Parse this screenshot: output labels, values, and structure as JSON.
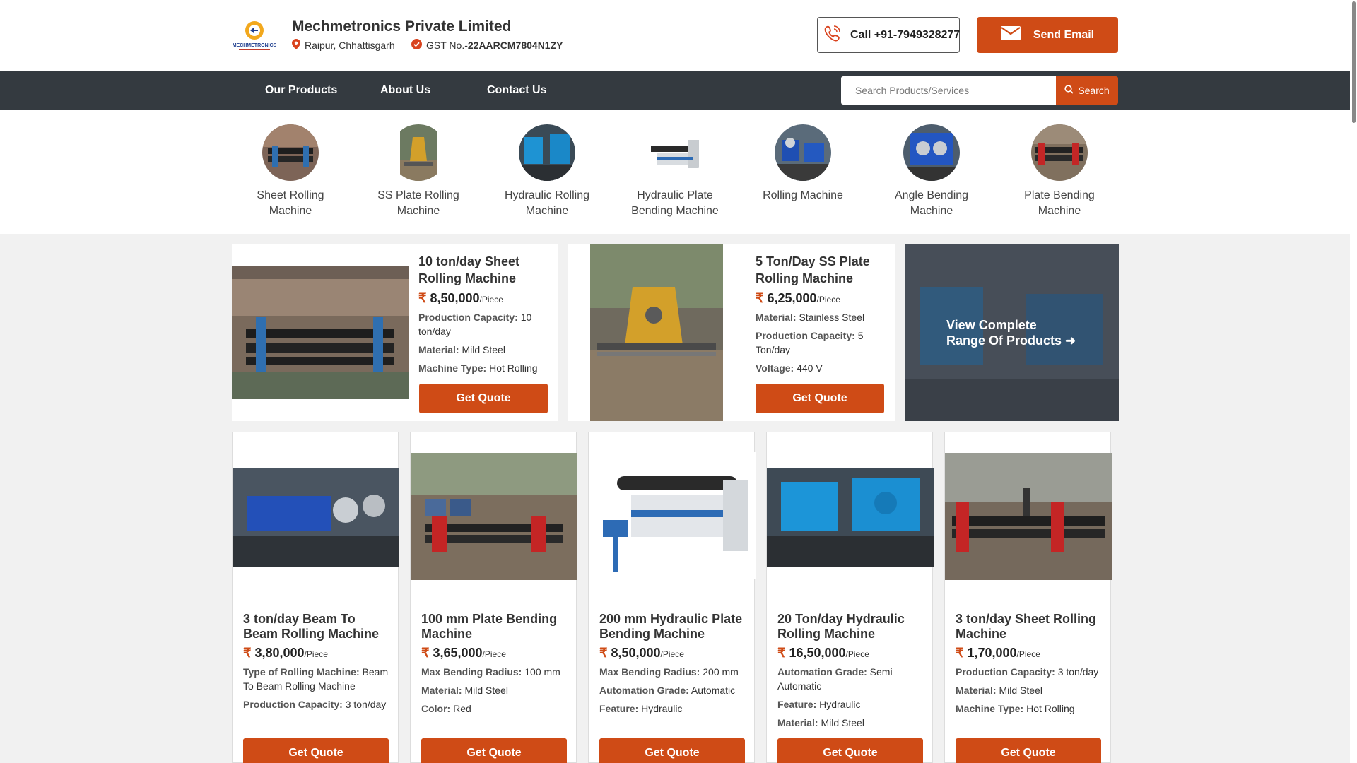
{
  "header": {
    "company": "Mechmetronics Private Limited",
    "location": "Raipur, Chhattisgarh",
    "gst_label": "GST No.-",
    "gst_value": "22AARCM7804N1ZY",
    "call": "Call +91-7949328277",
    "email": "Send Email",
    "logo_text": "MECHMETRONICS"
  },
  "nav": {
    "items": [
      "Our Products",
      "About Us",
      "Contact Us"
    ],
    "search_placeholder": "Search Products/Services",
    "search_button": "Search"
  },
  "categories": [
    "Sheet Rolling Machine",
    "SS Plate Rolling Machine",
    "Hydraulic Rolling Machine",
    "Hydraulic Plate Bending Machine",
    "Rolling Machine",
    "Angle Bending Machine",
    "Plate Bending Machine"
  ],
  "featured": [
    {
      "title": "10 ton/day Sheet Rolling Machine",
      "price": "8,50,000",
      "unit": "/Piece",
      "specs": [
        {
          "k": "Production Capacity:",
          "v": "10 ton/day"
        },
        {
          "k": "Material:",
          "v": "Mild Steel"
        },
        {
          "k": "Machine Type:",
          "v": "Hot Rolling"
        }
      ],
      "quote": "Get Quote"
    },
    {
      "title": "5 Ton/Day SS Plate Rolling Machine",
      "price": "6,25,000",
      "unit": "/Piece",
      "specs": [
        {
          "k": "Material:",
          "v": "Stainless Steel"
        },
        {
          "k": "Production Capacity:",
          "v": "5 Ton/day"
        },
        {
          "k": "Voltage:",
          "v": "440 V"
        }
      ],
      "quote": "Get Quote"
    }
  ],
  "view_all": {
    "line1": "View Complete",
    "line2": "Range Of Products"
  },
  "products": [
    {
      "title": "3 ton/day Beam To Beam Rolling Machine",
      "price": "3,80,000",
      "unit": "/Piece",
      "specs": [
        {
          "k": "Type of Rolling Machine:",
          "v": "Beam To Beam Rolling Machine"
        },
        {
          "k": "Production Capacity:",
          "v": "3 ton/day"
        }
      ],
      "quote": "Get Quote"
    },
    {
      "title": "100 mm Plate Bending Machine",
      "price": "3,65,000",
      "unit": "/Piece",
      "specs": [
        {
          "k": "Max Bending Radius:",
          "v": "100 mm"
        },
        {
          "k": "Material:",
          "v": "Mild Steel"
        },
        {
          "k": "Color:",
          "v": "Red"
        }
      ],
      "quote": "Get Quote"
    },
    {
      "title": "200 mm Hydraulic Plate Bending Machine",
      "price": "8,50,000",
      "unit": "/Piece",
      "specs": [
        {
          "k": "Max Bending Radius:",
          "v": "200 mm"
        },
        {
          "k": "Automation Grade:",
          "v": "Automatic"
        },
        {
          "k": "Feature:",
          "v": "Hydraulic"
        }
      ],
      "quote": "Get Quote"
    },
    {
      "title": "20 Ton/day Hydraulic Rolling Machine",
      "price": "16,50,000",
      "unit": "/Piece",
      "specs": [
        {
          "k": "Automation Grade:",
          "v": "Semi Automatic"
        },
        {
          "k": "Feature:",
          "v": "Hydraulic"
        },
        {
          "k": "Material:",
          "v": "Mild Steel"
        }
      ],
      "quote": "Get Quote"
    },
    {
      "title": "3 ton/day Sheet Rolling Machine",
      "price": "1,70,000",
      "unit": "/Piece",
      "specs": [
        {
          "k": "Production Capacity:",
          "v": "3 ton/day"
        },
        {
          "k": "Material:",
          "v": "Mild Steel"
        },
        {
          "k": "Machine Type:",
          "v": "Hot Rolling"
        }
      ],
      "quote": "Get Quote"
    }
  ],
  "colors": {
    "accent": "#cf4b16",
    "nav_bg": "#343a40"
  },
  "icons": [
    "location-pin-icon",
    "verified-check-icon",
    "phone-icon",
    "mail-icon",
    "search-icon",
    "arrow-right-icon"
  ]
}
